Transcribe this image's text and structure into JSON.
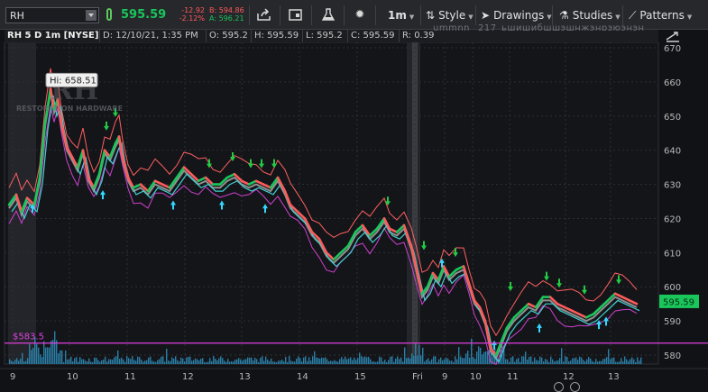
{
  "toolbar": {
    "symbol": "RH",
    "last_price": "595.59",
    "net_change": "-12.92",
    "pct_change": "-2.12%",
    "bid": "B: 594.86",
    "ask": "A: 596.21",
    "timeframe": "1m",
    "style_label": "Style",
    "drawings_label": "Drawings",
    "studies_label": "Studies",
    "patterns_label": "Patterns",
    "icons": [
      "share-icon",
      "calendar-icon",
      "flask-icon",
      "gear-icon"
    ]
  },
  "info_bar": {
    "title": "RH 5 D 1m [NYSE]",
    "date": "D: 12/10/21, 1:35 PM",
    "open": "O: 595.2",
    "high": "H: 595.59",
    "low": "L: 595.2",
    "close": "C: 595.59",
    "range": "R: 0.39",
    "overflow_1": "ummnn",
    "overflow_2": "217",
    "overflow_3": "ьшишибшшэшнжэнрзюэнэн"
  },
  "watermark": {
    "logo": "RH",
    "company": "RESTORATION HARDWARE"
  },
  "chart_data": {
    "type": "line",
    "symbol": "RH",
    "interval": "1m",
    "days": 5,
    "y_ticks": [
      670,
      660,
      650,
      640,
      630,
      620,
      610,
      600,
      590,
      580
    ],
    "ylim": [
      577,
      672
    ],
    "x_ticks": [
      "9",
      "10",
      "11",
      "12",
      "13",
      "14",
      "15",
      "Fri",
      "9",
      "10",
      "11",
      "12",
      "13"
    ],
    "high_annotation": "Hi: 658.51",
    "support_line_label": "$583.5",
    "support_line_value": 583.5,
    "current_price_label": "595.59",
    "colors": {
      "price_up": "#19c65a",
      "price_down": "#ff5a5a",
      "support_line": "#e040e0",
      "ma_fast": "#40d0d0",
      "ma_slow": "#909090",
      "band_upper": "#ff6060",
      "band_lower": "#d040d0",
      "volume": "#2a7fa8",
      "buy_arrow": "#22cc44",
      "sell_arrow": "#33d8ff"
    }
  }
}
